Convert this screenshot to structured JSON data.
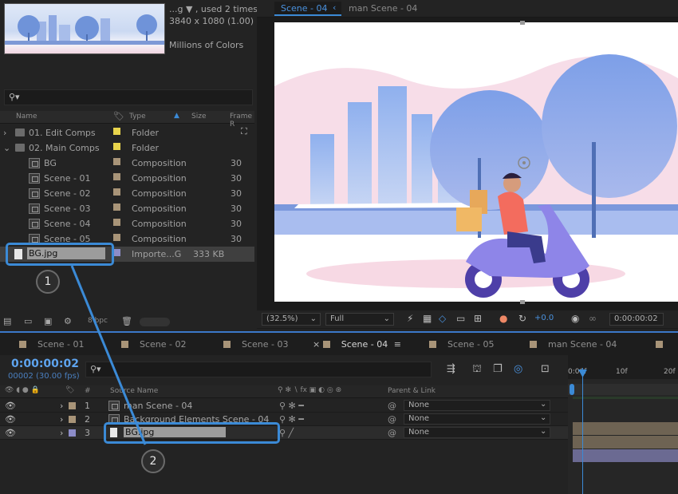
{
  "project": {
    "thumb_info": [
      "...g ▼ , used 2 times",
      "3840 x 1080 (1.00)",
      "",
      "Millions of Colors"
    ],
    "columns": {
      "name": "Name",
      "type": "Type",
      "size": "Size",
      "frame": "Frame R"
    },
    "rows": [
      {
        "name": "01. Edit Comps",
        "type": "Folder",
        "size": "",
        "frame": "",
        "kind": "folder",
        "color": "#e8d44c"
      },
      {
        "name": "02. Main Comps",
        "type": "Folder",
        "size": "",
        "frame": "",
        "kind": "folder",
        "color": "#e8d44c"
      },
      {
        "name": "BG",
        "type": "Composition",
        "size": "",
        "frame": "30",
        "kind": "comp",
        "color": "#a89478"
      },
      {
        "name": "Scene - 01",
        "type": "Composition",
        "size": "",
        "frame": "30",
        "kind": "comp",
        "color": "#a89478"
      },
      {
        "name": "Scene - 02",
        "type": "Composition",
        "size": "",
        "frame": "30",
        "kind": "comp",
        "color": "#a89478"
      },
      {
        "name": "Scene - 03",
        "type": "Composition",
        "size": "",
        "frame": "30",
        "kind": "comp",
        "color": "#a89478"
      },
      {
        "name": "Scene - 04",
        "type": "Composition",
        "size": "",
        "frame": "30",
        "kind": "comp",
        "color": "#a89478"
      },
      {
        "name": "Scene - 05",
        "type": "Composition",
        "size": "",
        "frame": "30",
        "kind": "comp",
        "color": "#a89478"
      },
      {
        "name": "BG.jpg",
        "type": "Importe...G",
        "size": "333 KB",
        "frame": "",
        "kind": "file",
        "color": "#8c8cc8"
      }
    ],
    "footer_bpc": "8 bpc"
  },
  "viewer": {
    "tabs": [
      "Scene - 04",
      "man Scene - 04"
    ],
    "zoom": "(32.5%)",
    "resolution": "Full",
    "exposure": "+0.0",
    "timecode": "0:00:00:02"
  },
  "timeline": {
    "tabs": [
      "Scene - 01",
      "Scene - 02",
      "Scene - 03",
      "Scene - 04",
      "Scene - 05",
      "man Scene - 04"
    ],
    "active_tab": "Scene - 04",
    "timecode": "0:00:00:02",
    "fps": "00002 (30.00 fps)",
    "columns": {
      "num": "#",
      "source": "Source Name",
      "parent": "Parent & Link"
    },
    "layers": [
      {
        "num": "1",
        "name": "man Scene - 04",
        "parent": "None",
        "color": "#a89478"
      },
      {
        "num": "2",
        "name": "Background Elements Scene - 04",
        "parent": "None",
        "color": "#a89478"
      },
      {
        "num": "3",
        "name": "BG.jpg",
        "parent": "None",
        "color": "#8c8cc8"
      }
    ],
    "ruler_labels": [
      "0:00f",
      "10f",
      "20f"
    ]
  },
  "callouts": [
    "1",
    "2"
  ],
  "accent": "#3b8ad6"
}
